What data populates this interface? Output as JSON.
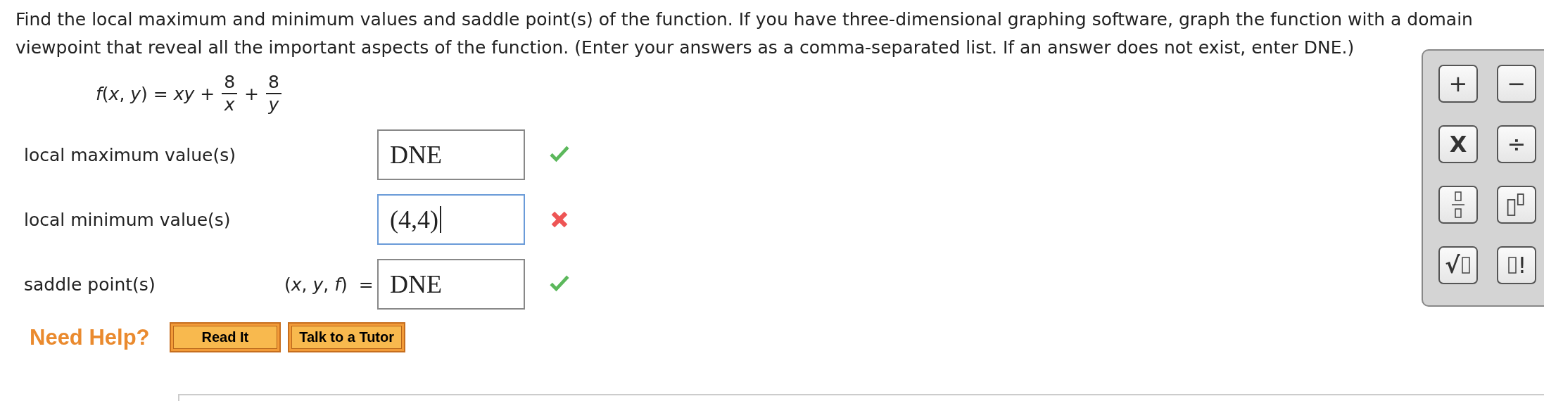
{
  "instructions": [
    "Find the local maximum and minimum values and saddle point(s) of the function. If you have three-dimensional graphing software, graph the function with a domain",
    "viewpoint that reveal all the important aspects of the function. (Enter your answers as a comma-separated list. If an answer does not exist, enter DNE.)"
  ],
  "formula": [
    {
      "kind": "text",
      "text": "*f*(*x*, *y*) = *xy* +"
    },
    {
      "kind": "frac",
      "num": "8",
      "den": "*x*"
    },
    {
      "kind": "text",
      "text": "+"
    },
    {
      "kind": "frac",
      "num": "8",
      "den": "*y*"
    }
  ],
  "answers": [
    {
      "label": "local maximum value(s)",
      "value": "DNE",
      "focused": false,
      "correct": true
    },
    {
      "label": "local minimum value(s)",
      "value": "(4,4)",
      "focused": true,
      "correct": false
    },
    {
      "label": "saddle point(s)",
      "prefix": "(*x*, *y*, *f*)  =",
      "value": "DNE",
      "focused": false,
      "correct": true
    }
  ],
  "help": {
    "label": "Need Help?",
    "buttons": [
      "Read It",
      "Talk to a Tutor"
    ]
  },
  "keypad": [
    {
      "kind": "char",
      "label": "+"
    },
    {
      "kind": "char",
      "label": "−"
    },
    {
      "kind": "char",
      "label": "X"
    },
    {
      "kind": "char",
      "label": "÷"
    },
    {
      "kind": "fraction"
    },
    {
      "kind": "power"
    },
    {
      "kind": "sqrt",
      "label": "√"
    },
    {
      "kind": "factorial",
      "label": "!"
    }
  ]
}
